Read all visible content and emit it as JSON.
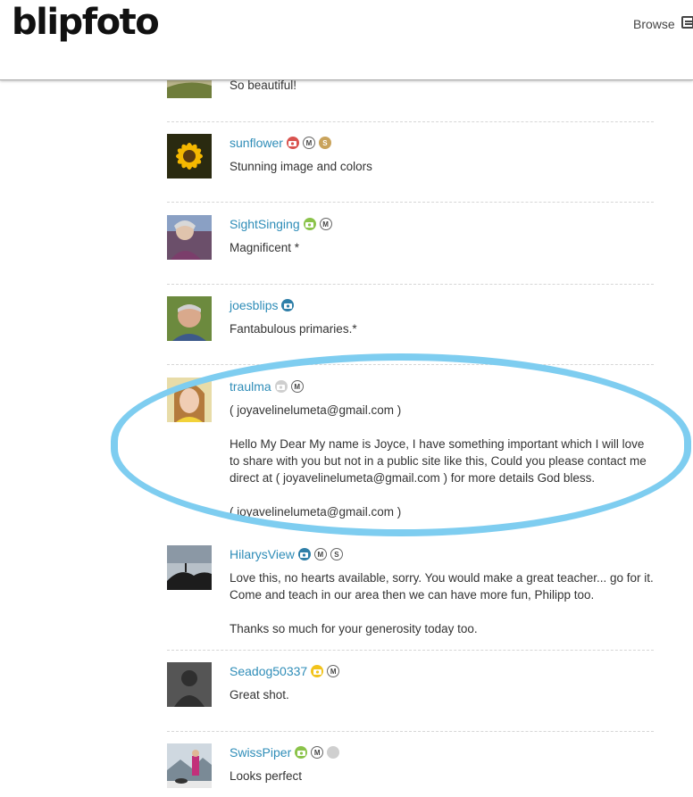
{
  "header": {
    "logo": "blipfoto",
    "browse_label": "Browse"
  },
  "comments": [
    {
      "text": [
        "So beautiful!"
      ]
    },
    {
      "name": "sunflower",
      "text": [
        "Stunning image and colors"
      ]
    },
    {
      "name": "SightSinging",
      "text": [
        "Magnificent *"
      ]
    },
    {
      "name": "joesblips",
      "text": [
        "Fantabulous primaries.*"
      ]
    },
    {
      "name": "traulma",
      "text": [
        "( joyavelinelumeta@gmail.com )",
        "Hello My Dear My name is Joyce, I have something important which I will love to share with you but not in a public site like this, Could you please contact me direct at ( joyavelinelumeta@gmail.com ) for more details God bless.",
        "( joyavelinelumeta@gmail.com )"
      ]
    },
    {
      "name": "HilarysView",
      "text": [
        "Love this, no hearts available, sorry. You would make a great teacher... go for it. Come and teach in our area then we can have more fun, Philipp too.",
        "Thanks so much for your generosity today too."
      ]
    },
    {
      "name": "Seadog50337",
      "text": [
        "Great shot."
      ]
    },
    {
      "name": "SwissPiper",
      "text": [
        "Looks perfect"
      ]
    }
  ],
  "badges": {
    "m_letter": "M",
    "s_letter": "S"
  },
  "colors": {
    "link": "#2f8db8",
    "highlight_ring": "#7ecdf0",
    "badge_red": "#d9534f",
    "badge_green": "#8bc34a",
    "badge_blue": "#2f7fa8",
    "badge_yellow": "#f2c31b",
    "badge_gold": "#c9a35b",
    "badge_gray": "#cfcfcf"
  }
}
